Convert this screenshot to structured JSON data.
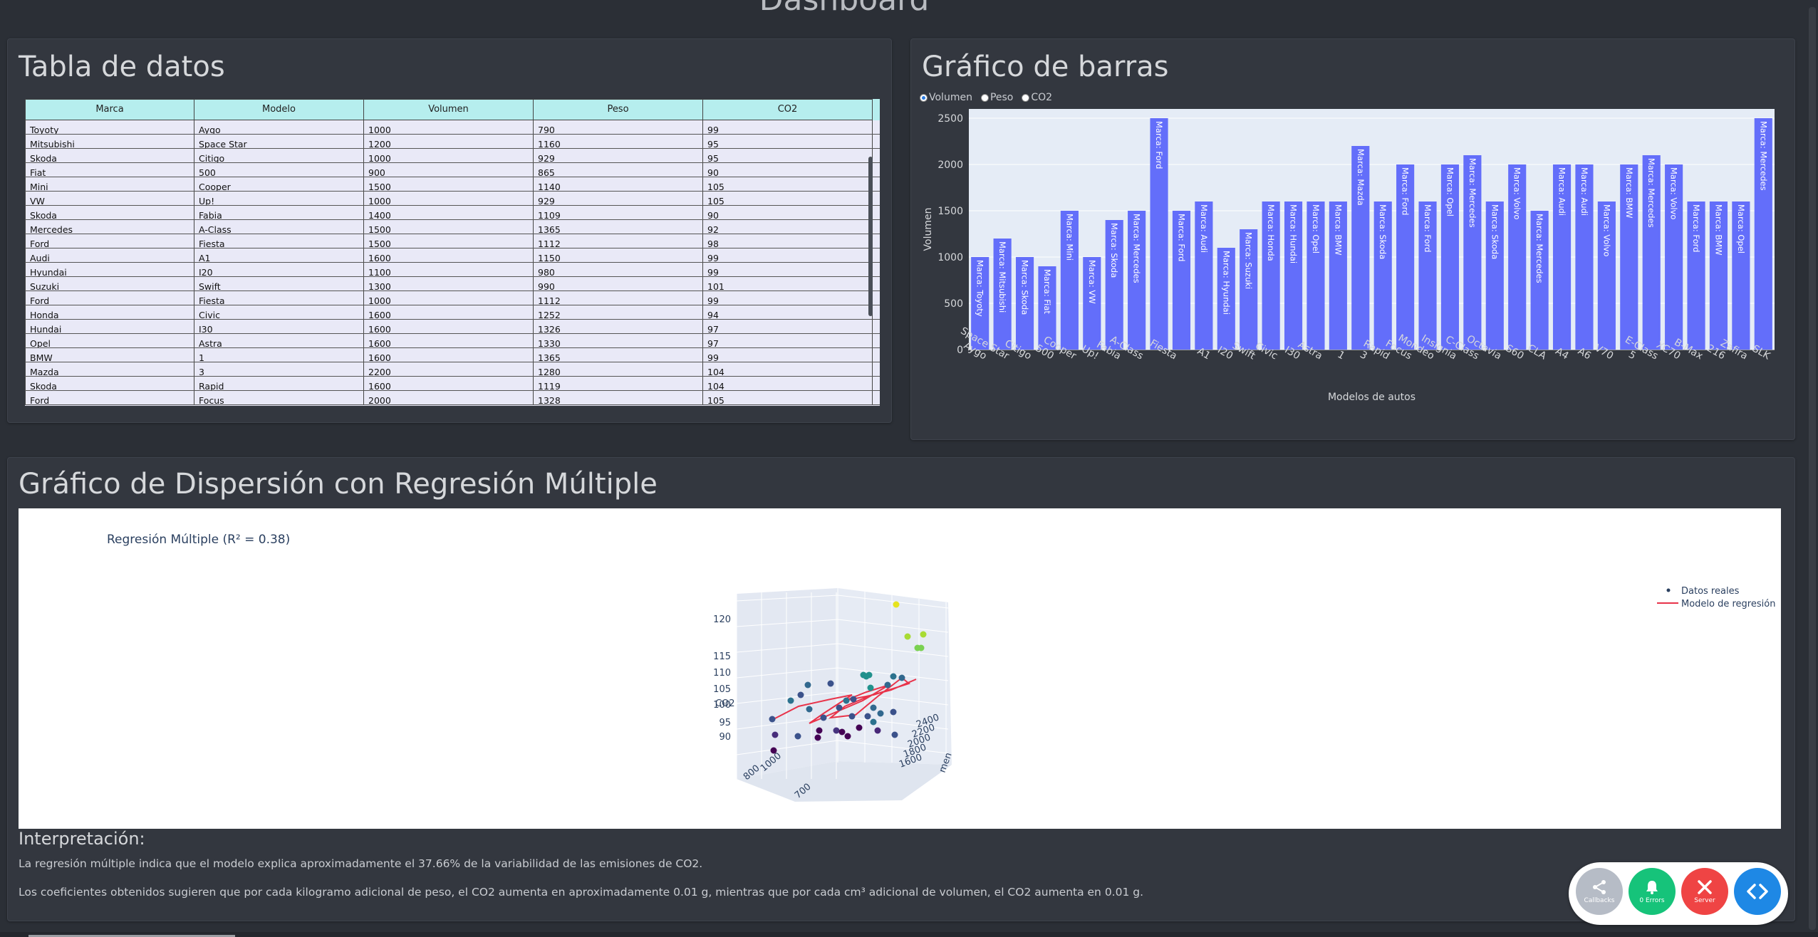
{
  "page": {
    "title": "Dashboard"
  },
  "table_panel": {
    "title": "Tabla de datos",
    "columns": [
      "Marca",
      "Modelo",
      "Volumen",
      "Peso",
      "CO2"
    ],
    "rows": [
      [
        "Toyoty",
        "Aygo",
        "1000",
        "790",
        "99"
      ],
      [
        "Mitsubishi",
        "Space Star",
        "1200",
        "1160",
        "95"
      ],
      [
        "Skoda",
        "Citigo",
        "1000",
        "929",
        "95"
      ],
      [
        "Fiat",
        "500",
        "900",
        "865",
        "90"
      ],
      [
        "Mini",
        "Cooper",
        "1500",
        "1140",
        "105"
      ],
      [
        "VW",
        "Up!",
        "1000",
        "929",
        "105"
      ],
      [
        "Skoda",
        "Fabia",
        "1400",
        "1109",
        "90"
      ],
      [
        "Mercedes",
        "A-Class",
        "1500",
        "1365",
        "92"
      ],
      [
        "Ford",
        "Fiesta",
        "1500",
        "1112",
        "98"
      ],
      [
        "Audi",
        "A1",
        "1600",
        "1150",
        "99"
      ],
      [
        "Hyundai",
        "I20",
        "1100",
        "980",
        "99"
      ],
      [
        "Suzuki",
        "Swift",
        "1300",
        "990",
        "101"
      ],
      [
        "Ford",
        "Fiesta",
        "1000",
        "1112",
        "99"
      ],
      [
        "Honda",
        "Civic",
        "1600",
        "1252",
        "94"
      ],
      [
        "Hundai",
        "I30",
        "1600",
        "1326",
        "97"
      ],
      [
        "Opel",
        "Astra",
        "1600",
        "1330",
        "97"
      ],
      [
        "BMW",
        "1",
        "1600",
        "1365",
        "99"
      ],
      [
        "Mazda",
        "3",
        "2200",
        "1280",
        "104"
      ],
      [
        "Skoda",
        "Rapid",
        "1600",
        "1119",
        "104"
      ],
      [
        "Ford",
        "Focus",
        "2000",
        "1328",
        "105"
      ]
    ]
  },
  "bar_panel": {
    "title": "Gráfico de barras",
    "radio_options": [
      "Volumen",
      "Peso",
      "CO2"
    ],
    "selected": "Volumen"
  },
  "scatter_panel": {
    "title": "Gráfico de Dispersión con Regresión Múltiple",
    "plot_title": "Regresión Múltiple (R² = 0.38)",
    "legend": [
      "Datos reales",
      "Modelo de regresión"
    ],
    "z_label": "CO2",
    "z_ticks": [
      "90",
      "95",
      "100",
      "105",
      "110",
      "115",
      "120"
    ],
    "volume_ticks": [
      "2400",
      "2200",
      "2000",
      "1800",
      "1600"
    ],
    "weight_ticks": [
      "1000",
      "800"
    ],
    "volume_label_fragment": "men",
    "weight_label_fragment": "700"
  },
  "interpretation": {
    "title": "Interpretación:",
    "p1": "La regresión múltiple indica que el modelo explica aproximadamente el 37.66% de la variabilidad de las emisiones de CO2.",
    "p2": "Los coeficientes obtenidos sugieren que por cada kilogramo adicional de peso, el CO2 aumenta en aproximadamente 0.01 g, mientras que por cada cm³ adicional de volumen, el CO2 aumenta en 0.01 g."
  },
  "debug_menu": {
    "callbacks": "Callbacks",
    "errors": "0 Errors",
    "server": "Server"
  },
  "colors": {
    "bar": "#636efa",
    "plot_bg": "#e5ecf6",
    "table_header": "#b6eeee",
    "regression": "#e8334a"
  },
  "chart_data": [
    {
      "type": "bar",
      "categories": [
        "Aygo",
        "Space Star",
        "Citigo",
        "500",
        "Cooper",
        "Up!",
        "Fabia",
        "A-Class",
        "Fiesta",
        "Fiesta",
        "A1",
        "I20",
        "Swift",
        "Civic",
        "I30",
        "Astra",
        "1",
        "3",
        "Rapid",
        "Focus",
        "Mondeo",
        "Insignia",
        "C-Class",
        "Octavia",
        "S60",
        "CLA",
        "A4",
        "A6",
        "V70",
        "5",
        "E-Class",
        "XC70",
        "B-Max",
        "216",
        "Zafira",
        "SLK"
      ],
      "x_ticks": [
        "Aygo",
        "Space Star",
        "Citigo",
        "500",
        "Cooper",
        "Up!",
        "Fabia",
        "A-Class",
        "Fiesta",
        "A1",
        "I20",
        "Swift",
        "Civic",
        "I30",
        "Astra",
        "1",
        "3",
        "Rapid",
        "Focus",
        "Mondeo",
        "Insignia",
        "C-Class",
        "Octavia",
        "S60",
        "CLA",
        "A4",
        "A6",
        "V70",
        "5",
        "E-Class",
        "XC70",
        "B-Max",
        "216",
        "Zafira",
        "SLK"
      ],
      "series": [
        {
          "values": [
            1000,
            1200,
            1000,
            900,
            1500,
            1000,
            1400,
            1500,
            2500,
            1500,
            1600,
            1100,
            1300,
            1600,
            1600,
            1600,
            1600,
            2200,
            1600,
            2000,
            1600,
            2000,
            2100,
            1600,
            2000,
            1500,
            2000,
            2000,
            1600,
            2000,
            2100,
            2000,
            1600,
            1600,
            1600,
            2500
          ],
          "labels": [
            "Marca: Toyoty",
            "Marca: Mitsubishi",
            "Marca: Skoda",
            "Marca: Fiat",
            "Marca: Mini",
            "Marca: VW",
            "Marca: Skoda",
            "Marca: Mercedes",
            "Marca: Ford",
            "Marca: Ford",
            "Marca: Audi",
            "Marca: Hyundai",
            "Marca: Suzuki",
            "Marca: Honda",
            "Marca: Hundai",
            "Marca: Opel",
            "Marca: BMW",
            "Marca: Mazda",
            "Marca: Skoda",
            "Marca: Ford",
            "Marca: Ford",
            "Marca: Opel",
            "Marca: Mercedes",
            "Marca: Skoda",
            "Marca: Volvo",
            "Marca: Mercedes",
            "Marca: Audi",
            "Marca: Audi",
            "Marca: Volvo",
            "Marca: BMW",
            "Marca: Mercedes",
            "Marca: Volvo",
            "Marca: Ford",
            "Marca: BMW",
            "Marca: Opel",
            "Marca: Mercedes"
          ]
        }
      ],
      "xlabel": "Modelos de autos",
      "ylabel": "Volumen",
      "ylim": [
        0,
        2600
      ],
      "y_ticks": [
        0,
        500,
        1000,
        1500,
        2000,
        2500
      ],
      "grid": true
    }
  ]
}
